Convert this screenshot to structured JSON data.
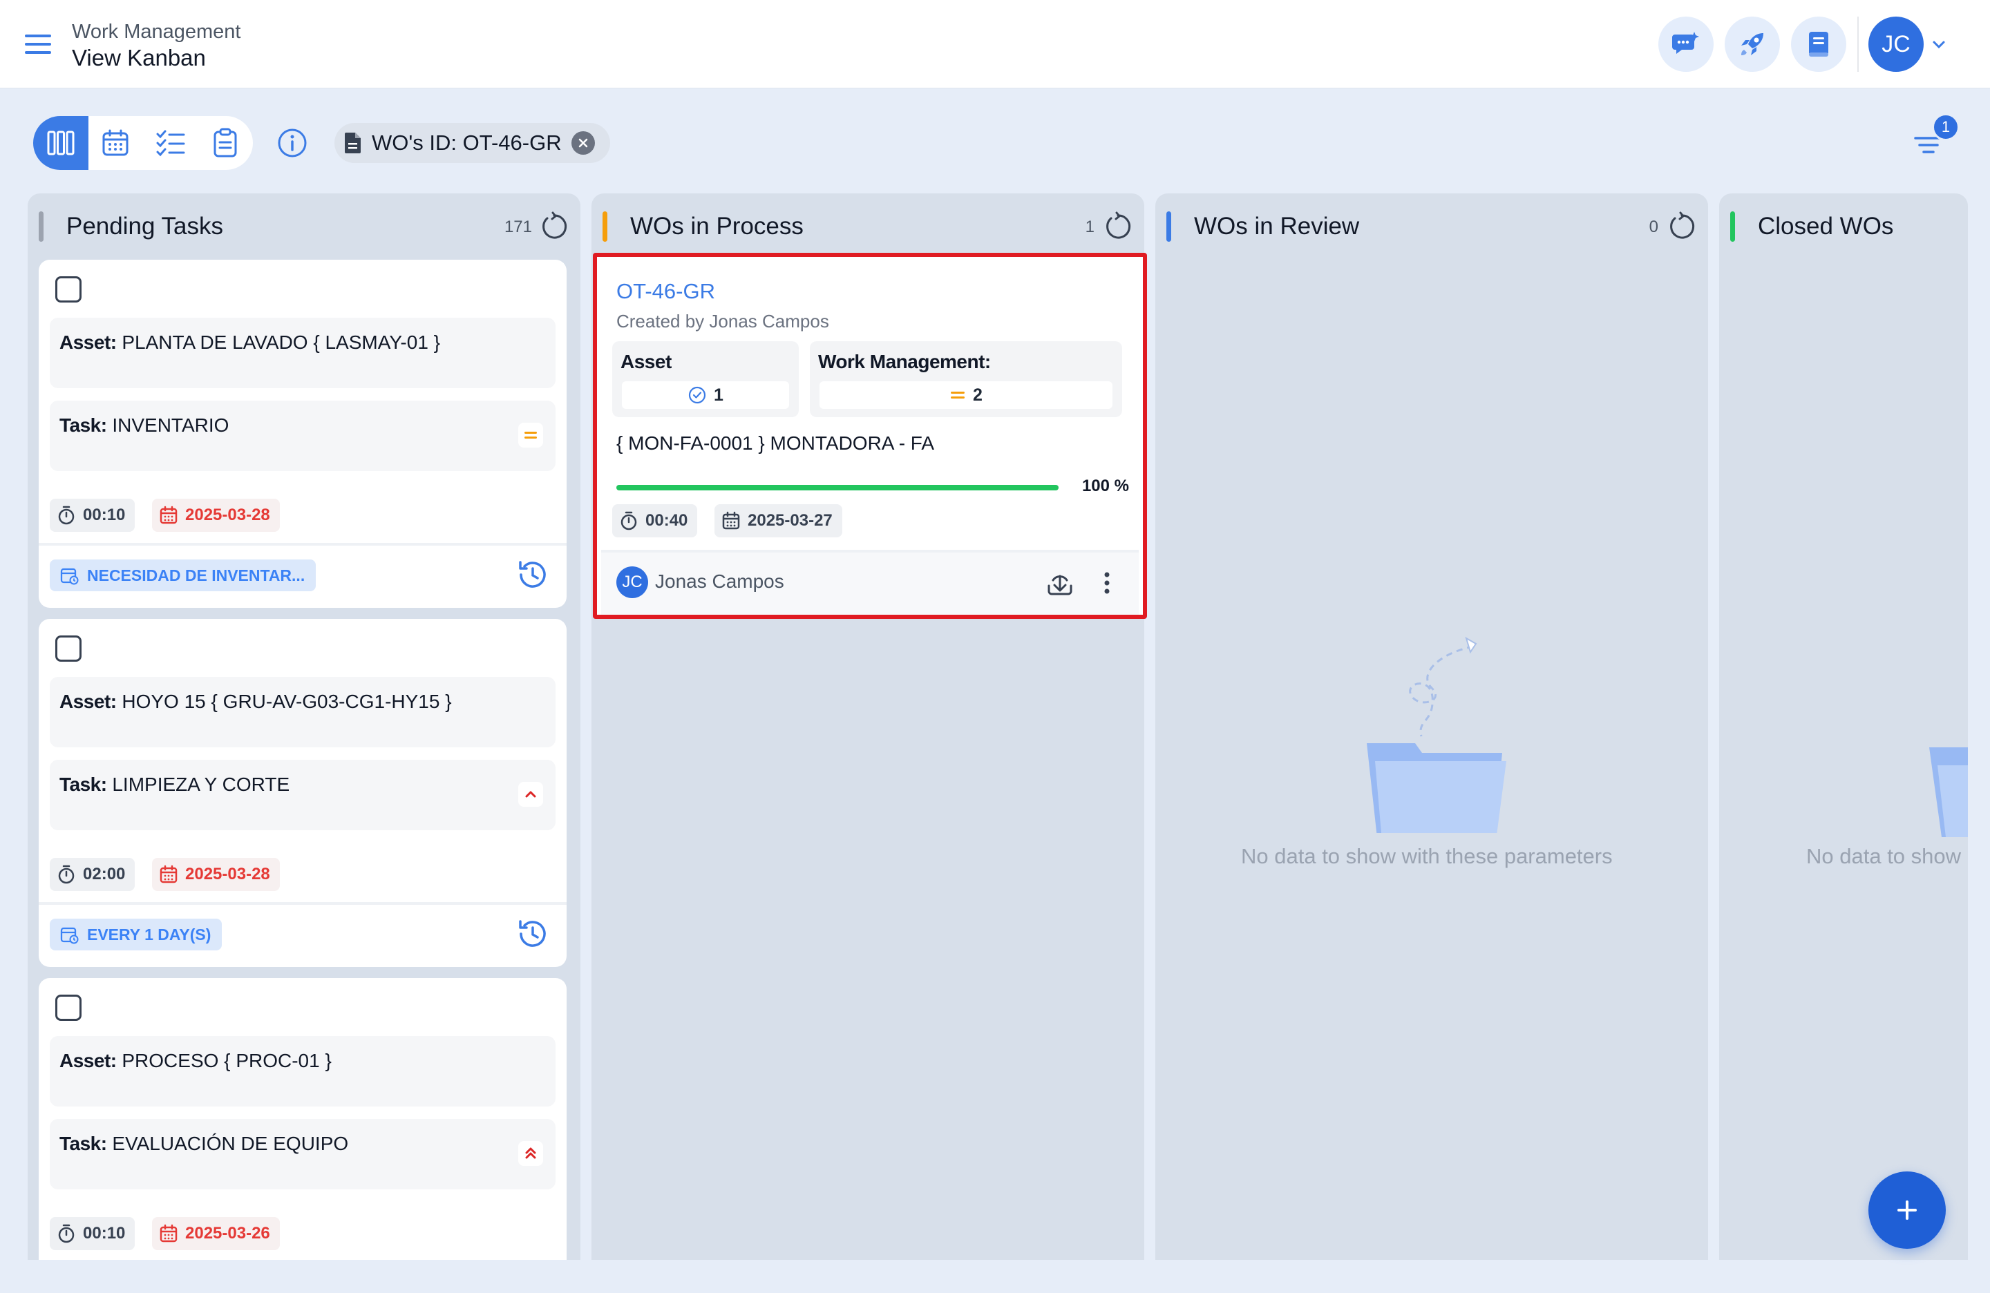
{
  "header": {
    "section": "Work Management",
    "title": "View Kanban",
    "user_initials": "JC",
    "icons": [
      "menu-icon",
      "ai-chat-icon",
      "rocket-icon",
      "book-icon",
      "chevron-down-icon"
    ]
  },
  "toolbar": {
    "views": [
      "kanban-view-icon",
      "calendar-view-icon",
      "checklist-view-icon",
      "clipboard-view-icon"
    ],
    "active_view": "kanban",
    "filter_chip": "WO's ID: OT-46-GR",
    "filter_count": "1"
  },
  "columns": [
    {
      "title": "Pending Tasks",
      "count": "171",
      "accent": "#9ca3af",
      "tasks": [
        {
          "asset_label": "Asset:",
          "asset": "PLANTA DE LAVADO { LASMAY-01 }",
          "task_label": "Task:",
          "task": "INVENTARIO",
          "priority": "medium",
          "time": "00:10",
          "date": "2025-03-28",
          "schedule": "NECESIDAD DE INVENTAR..."
        },
        {
          "asset_label": "Asset:",
          "asset": "HOYO 15 { GRU-AV-G03-CG1-HY15 }",
          "task_label": "Task:",
          "task": "LIMPIEZA Y CORTE",
          "priority": "high",
          "time": "02:00",
          "date": "2025-03-28",
          "schedule": "EVERY 1 DAY(S)"
        },
        {
          "asset_label": "Asset:",
          "asset": "PROCESO { PROC-01 }",
          "task_label": "Task:",
          "task": "EVALUACIÓN DE EQUIPO",
          "priority": "urgent",
          "time": "00:10",
          "date": "2025-03-26",
          "schedule": ""
        }
      ]
    },
    {
      "title": "WOs in Process",
      "count": "1",
      "accent": "#f59e0b",
      "workorder": {
        "id": "OT-46-GR",
        "created_by": "Created by Jonas Campos",
        "asset_label": "Asset",
        "asset_count": "1",
        "wm_label": "Work Management:",
        "wm_count": "2",
        "asset_name": "{ MON-FA-0001 } MONTADORA - FA",
        "progress": 100,
        "progress_label": "100 %",
        "time": "00:40",
        "date": "2025-03-27",
        "user_initials": "JC",
        "user": "Jonas Campos"
      }
    },
    {
      "title": "WOs in Review",
      "count": "0",
      "accent": "#3b7be5",
      "empty_text": "No data to show with these parameters"
    },
    {
      "title": "Closed WOs",
      "accent": "#22c55e",
      "empty_text": "No data to show"
    }
  ],
  "colors": {
    "primary": "#2f6fe0",
    "danger": "#e53935",
    "success": "#22c55e",
    "highlight": "#e01b22"
  }
}
